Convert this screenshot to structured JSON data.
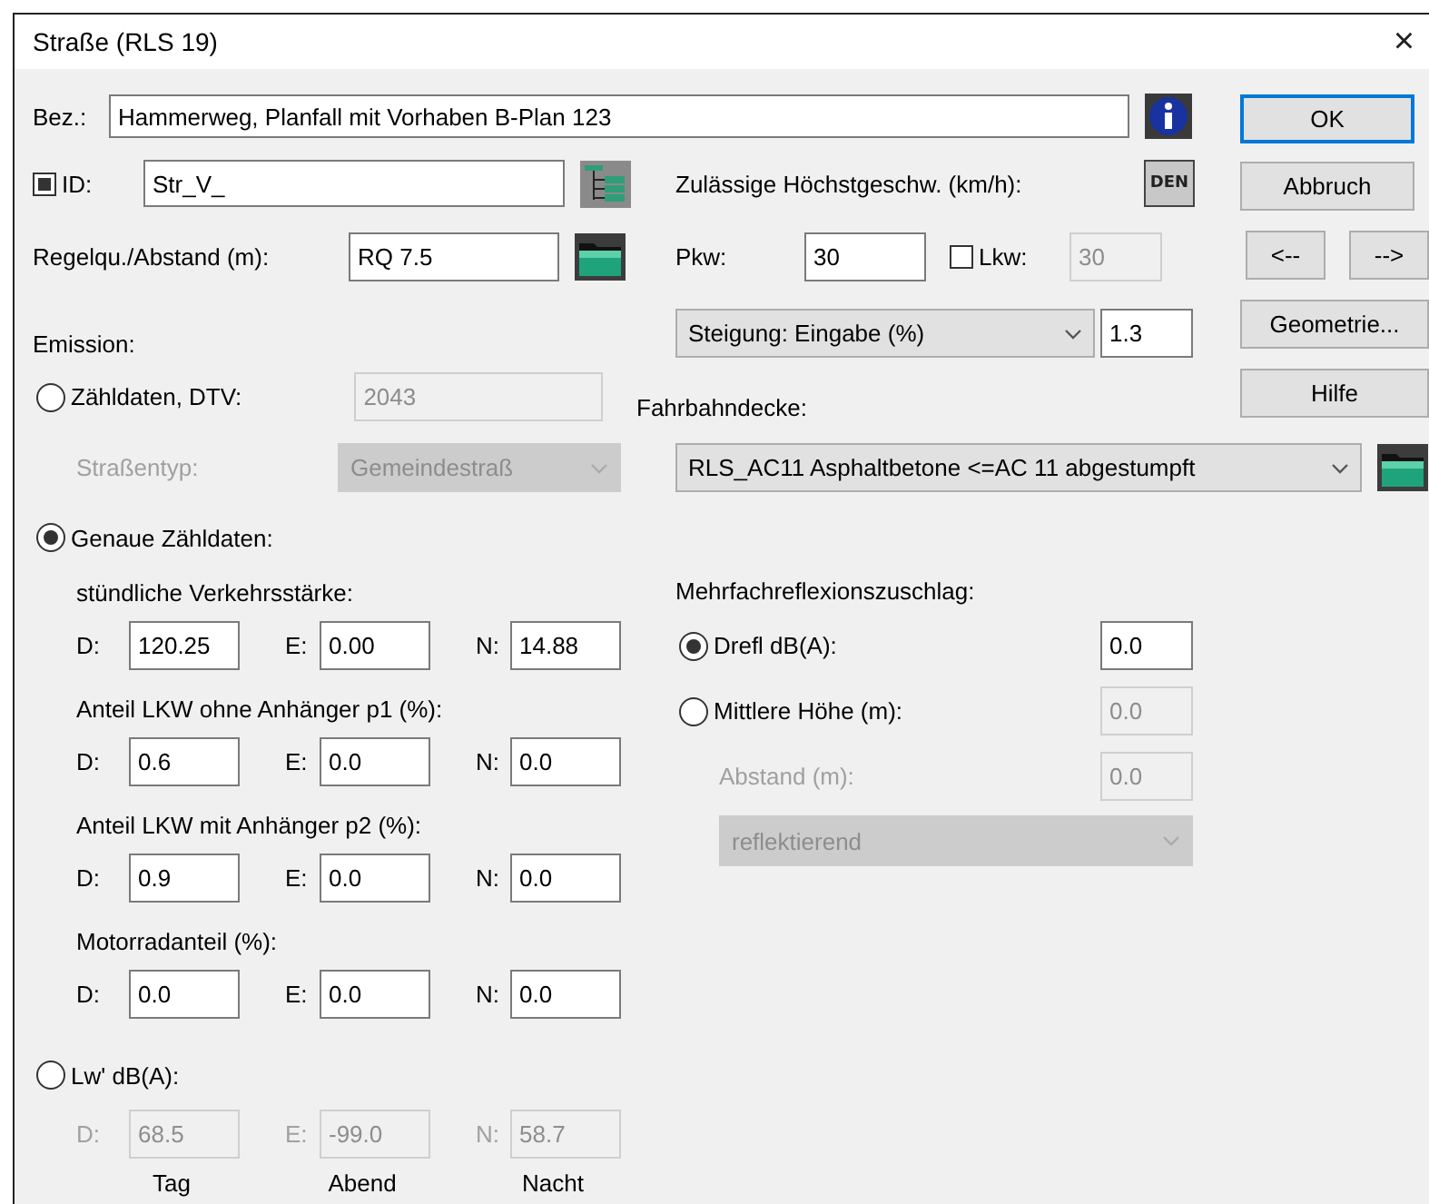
{
  "window": {
    "title": "Straße (RLS 19)",
    "close": "×"
  },
  "name": {
    "label": "Bez.:",
    "value": "Hammerweg, Planfall mit Vorhaben B-Plan 123"
  },
  "id": {
    "checked": true,
    "label": "ID:",
    "value": "Str_V_"
  },
  "cross_section": {
    "label": "Regelqu./Abstand (m):",
    "value": "RQ 7.5"
  },
  "speed": {
    "label": "Zulässige Höchstgeschw. (km/h):",
    "den": "DEN",
    "pkw_label": "Pkw:",
    "pkw_value": "30",
    "lkw_checked": false,
    "lkw_label": "Lkw:",
    "lkw_value": "30"
  },
  "emission_label": "Emission:",
  "gradient": {
    "mode": "Steigung: Eingabe (%)",
    "value": "1.3"
  },
  "surface": {
    "label": "Fahrbahndecke:",
    "value": "RLS_AC11 Asphaltbetone <=AC 11 abgestumpft"
  },
  "dtv": {
    "label": "Zähldaten, DTV:",
    "selected": false,
    "value": "2043",
    "type_label": "Straßentyp:",
    "type_value": "Gemeindestraß"
  },
  "exact": {
    "label": "Genaue Zähldaten:",
    "selected": true,
    "groups": [
      {
        "label": "stündliche Verkehrsstärke:",
        "cells": [
          {
            "label": "D:",
            "value": "120.25"
          },
          {
            "label": "E:",
            "value": "0.00"
          },
          {
            "label": "N:",
            "value": "14.88"
          }
        ]
      },
      {
        "label": "Anteil LKW ohne Anhänger p1 (%):",
        "cells": [
          {
            "label": "D:",
            "value": "0.6"
          },
          {
            "label": "E:",
            "value": "0.0"
          },
          {
            "label": "N:",
            "value": "0.0"
          }
        ]
      },
      {
        "label": "Anteil LKW mit Anhänger p2 (%):",
        "cells": [
          {
            "label": "D:",
            "value": "0.9"
          },
          {
            "label": "E:",
            "value": "0.0"
          },
          {
            "label": "N:",
            "value": "0.0"
          }
        ]
      },
      {
        "label": "Motorradanteil (%):",
        "cells": [
          {
            "label": "D:",
            "value": "0.0"
          },
          {
            "label": "E:",
            "value": "0.0"
          },
          {
            "label": "N:",
            "value": "0.0"
          }
        ]
      }
    ]
  },
  "lw": {
    "label": "Lw' dB(A):",
    "selected": false,
    "cells": [
      {
        "label": "D:",
        "value": "68.5"
      },
      {
        "label": "E:",
        "value": "-99.0"
      },
      {
        "label": "N:",
        "value": "58.7"
      }
    ],
    "periods": [
      "Tag",
      "Abend",
      "Nacht"
    ]
  },
  "reflection": {
    "label": "Mehrfachreflexionszuschlag:",
    "options": [
      {
        "label": "Drefl dB(A):",
        "selected": true,
        "value": "0.0"
      },
      {
        "label": "Mittlere Höhe (m):",
        "selected": false,
        "value": "0.0"
      }
    ],
    "distance_label": "Abstand (m):",
    "distance_value": "0.0",
    "reflector": "reflektierend"
  },
  "buttons": {
    "ok": "OK",
    "cancel": "Abbruch",
    "prev": "<--",
    "next": "-->",
    "geometry": "Geometrie...",
    "help": "Hilfe"
  }
}
